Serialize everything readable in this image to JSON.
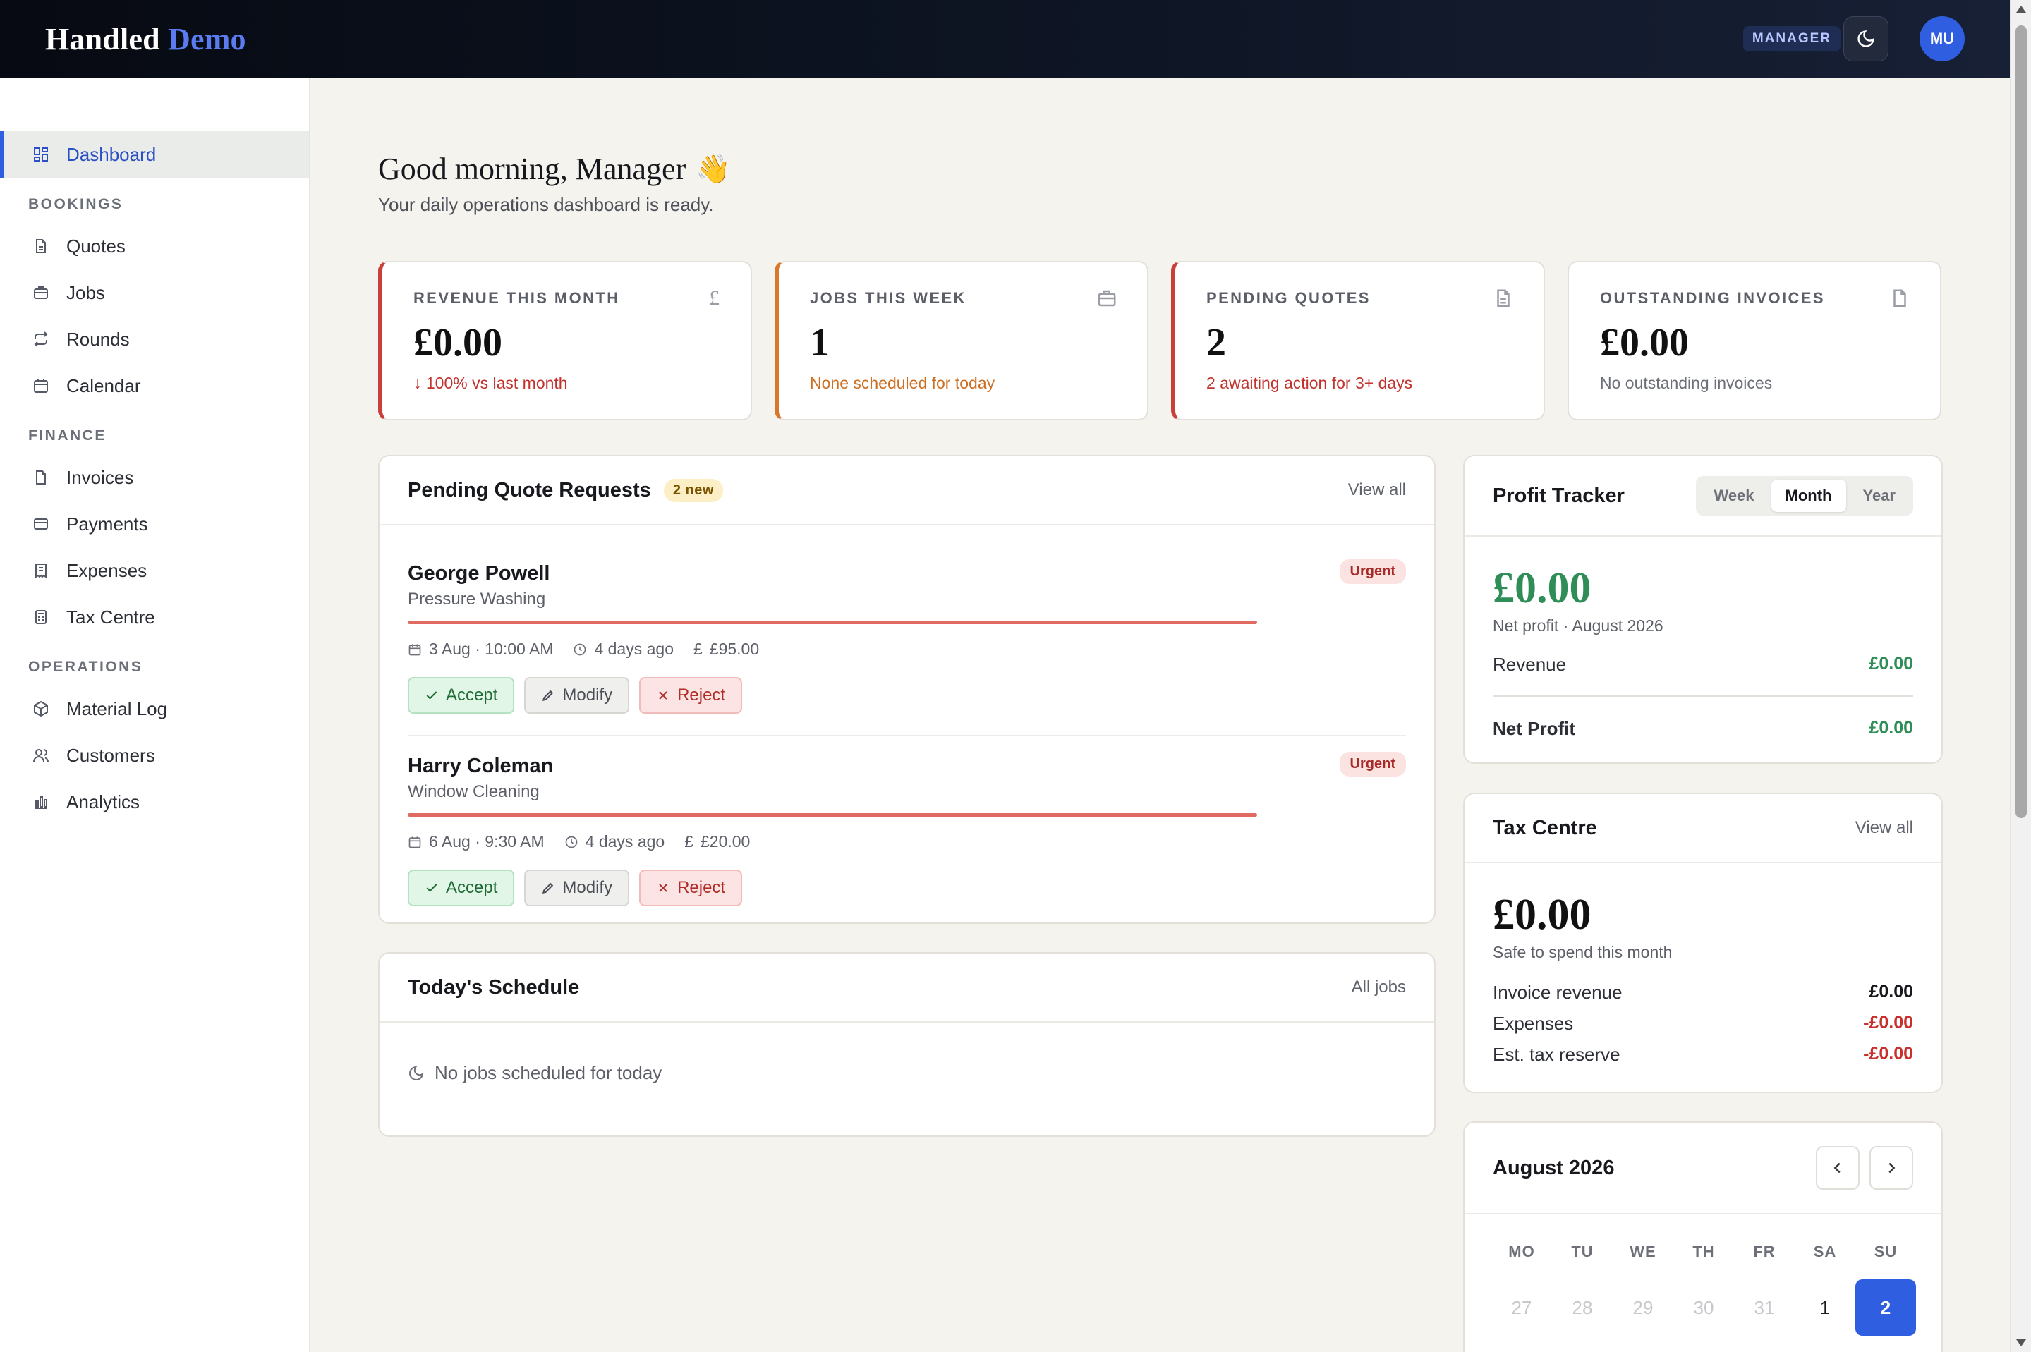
{
  "brand": {
    "name": "Handled",
    "accent": "Demo"
  },
  "header": {
    "role": "MANAGER",
    "avatar_initials": "MU"
  },
  "sidebar": {
    "dashboard": "Dashboard",
    "sections": {
      "bookings": "BOOKINGS",
      "finance": "FINANCE",
      "operations": "OPERATIONS"
    },
    "items": {
      "quotes": "Quotes",
      "jobs": "Jobs",
      "rounds": "Rounds",
      "calendar": "Calendar",
      "invoices": "Invoices",
      "payments": "Payments",
      "expenses": "Expenses",
      "tax_centre": "Tax Centre",
      "material_log": "Material Log",
      "customers": "Customers",
      "analytics": "Analytics"
    }
  },
  "greeting": {
    "title": "Good morning, Manager",
    "emoji": "👋",
    "subtitle": "Your daily operations dashboard is ready."
  },
  "stats": [
    {
      "label": "REVENUE THIS MONTH",
      "value": "£0.00",
      "note": "↓ 100% vs last month",
      "icon": "pound-icon"
    },
    {
      "label": "JOBS THIS WEEK",
      "value": "1",
      "note": "None scheduled for today",
      "icon": "briefcase-icon"
    },
    {
      "label": "PENDING QUOTES",
      "value": "2",
      "note": "2 awaiting action for 3+ days",
      "icon": "document-icon"
    },
    {
      "label": "OUTSTANDING INVOICES",
      "value": "£0.00",
      "note": "No outstanding invoices",
      "icon": "file-icon"
    }
  ],
  "pending_quotes": {
    "title": "Pending Quote Requests",
    "badge": "2 new",
    "link": "View all",
    "items": [
      {
        "name": "George Powell",
        "service": "Pressure Washing",
        "tag": "Urgent",
        "date": "3 Aug · 10:00 AM",
        "age": "4 days ago",
        "amount": "£95.00"
      },
      {
        "name": "Harry Coleman",
        "service": "Window Cleaning",
        "tag": "Urgent",
        "date": "6 Aug · 9:30 AM",
        "age": "4 days ago",
        "amount": "£20.00"
      }
    ],
    "actions": {
      "accept": "Accept",
      "modify": "Modify",
      "reject": "Reject"
    }
  },
  "schedule": {
    "title": "Today's Schedule",
    "link": "All jobs",
    "empty": "No jobs scheduled for today"
  },
  "profit": {
    "title": "Profit Tracker",
    "periods": [
      "Week",
      "Month",
      "Year"
    ],
    "selected_period": "Month",
    "value": "£0.00",
    "caption": "Net profit · August 2026",
    "revenue_label": "Revenue",
    "revenue_value": "£0.00",
    "net_label": "Net Profit",
    "net_value": "£0.00"
  },
  "tax": {
    "title": "Tax Centre",
    "link": "View all",
    "value": "£0.00",
    "caption": "Safe to spend this month",
    "rows": [
      {
        "label": "Invoice revenue",
        "value": "£0.00"
      },
      {
        "label": "Expenses",
        "value": "-£0.00"
      },
      {
        "label": "Est. tax reserve",
        "value": "-£0.00"
      }
    ]
  },
  "calendar": {
    "title": "August 2026",
    "weekdays": [
      "MO",
      "TU",
      "WE",
      "TH",
      "FR",
      "SA",
      "SU"
    ],
    "first_row": [
      "27",
      "28",
      "29",
      "30",
      "31",
      "1",
      "2"
    ],
    "selected_day": "2"
  }
}
